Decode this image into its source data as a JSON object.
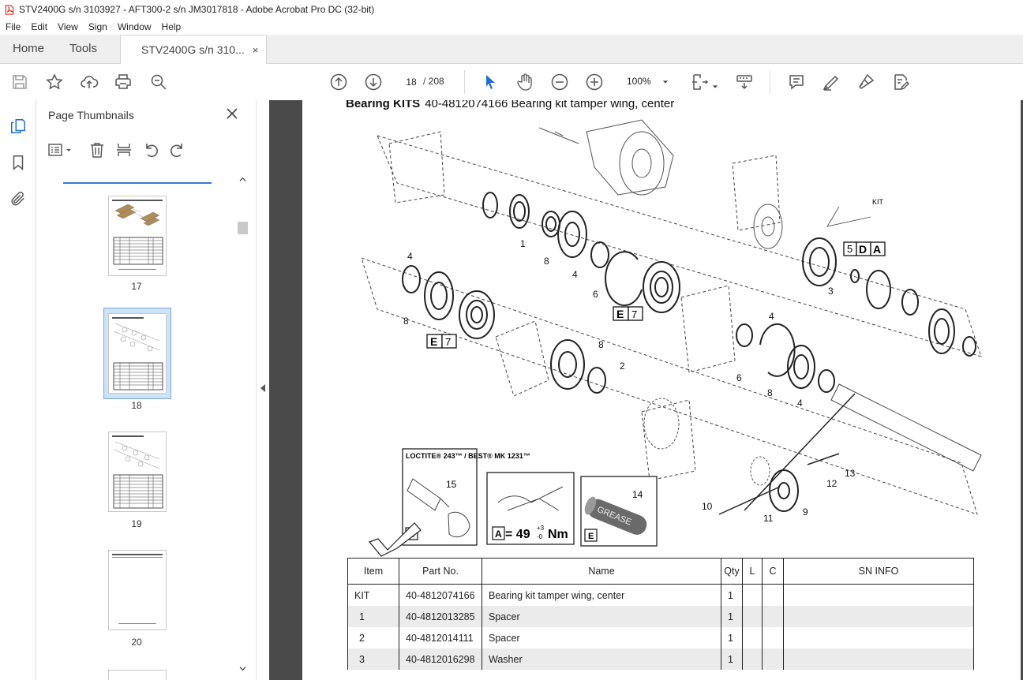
{
  "window": {
    "title": "STV2400G s/n 3103927 - AFT300-2 s/n JM3017818 - Adobe Acrobat Pro DC (32-bit)"
  },
  "menu": [
    "File",
    "Edit",
    "View",
    "Sign",
    "Window",
    "Help"
  ],
  "tabs": {
    "home": "Home",
    "tools": "Tools",
    "document": "STV2400G s/n 310...",
    "close": "×"
  },
  "toolbar": {
    "current_page": "18",
    "page_total": "/ 208",
    "zoom": "100%"
  },
  "panel": {
    "title": "Page Thumbnails",
    "thumbnails": [
      {
        "label": "17"
      },
      {
        "label": "18"
      },
      {
        "label": "19"
      },
      {
        "label": "20"
      }
    ]
  },
  "document": {
    "heading_bold": "Bearing KITS",
    "heading_rest": "40-4812074166 Bearing kit tamper wing, center",
    "diagram": {
      "callouts": [
        "KIT",
        "1",
        "2",
        "3",
        "4",
        "6",
        "8",
        "9",
        "10",
        "11",
        "12",
        "13",
        "14",
        "15"
      ],
      "loctite_label": "LOCTITE® 243™ / BEST® MK 1231™",
      "torque_label": "= 49",
      "torque_tol_plus": "+3",
      "torque_tol_minus": "-0",
      "torque_unit": "Nm",
      "grease_label": "GREASE",
      "box_d": "D",
      "box_a": "A",
      "box_e": "E",
      "ref_5": "5",
      "ref_7": "7"
    },
    "table": {
      "headers": [
        "Item",
        "Part No.",
        "Name",
        "Qty",
        "L",
        "C",
        "SN INFO"
      ],
      "rows": [
        {
          "item": "KIT",
          "part": "40-4812074166",
          "name": "Bearing kit tamper wing, center",
          "qty": "1"
        },
        {
          "item": "1",
          "part": "40-4812013285",
          "name": "Spacer",
          "qty": "1"
        },
        {
          "item": "2",
          "part": "40-4812014111",
          "name": "Spacer",
          "qty": "1"
        },
        {
          "item": "3",
          "part": "40-4812016298",
          "name": "Washer",
          "qty": "1"
        }
      ]
    }
  }
}
